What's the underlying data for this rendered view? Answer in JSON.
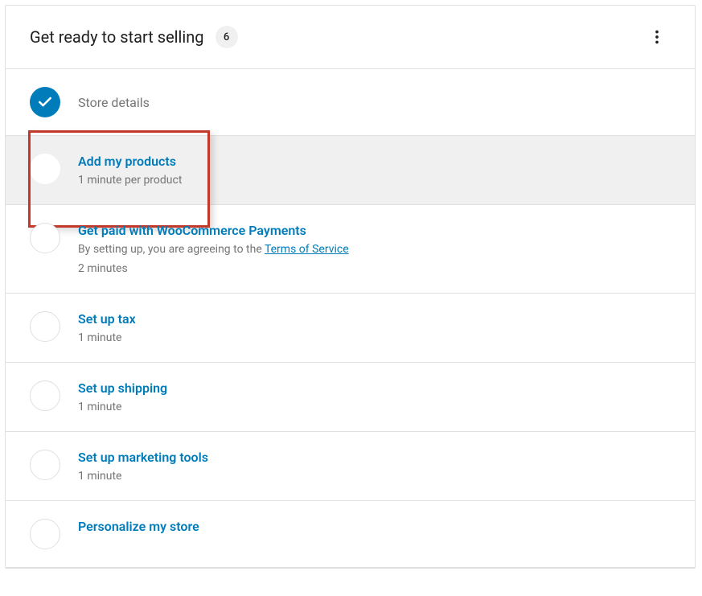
{
  "header": {
    "title": "Get ready to start selling",
    "count": "6"
  },
  "tasks": [
    {
      "title": "Store details",
      "completed": true
    },
    {
      "title": "Add my products",
      "time": "1 minute per product",
      "highlighted": true
    },
    {
      "title": "Get paid with WooCommerce Payments",
      "desc_prefix": "By setting up, you are agreeing to the ",
      "link_text": "Terms of Service",
      "time": "2 minutes"
    },
    {
      "title": "Set up tax",
      "time": "1 minute"
    },
    {
      "title": "Set up shipping",
      "time": "1 minute"
    },
    {
      "title": "Set up marketing tools",
      "time": "1 minute"
    },
    {
      "title": "Personalize my store"
    }
  ]
}
